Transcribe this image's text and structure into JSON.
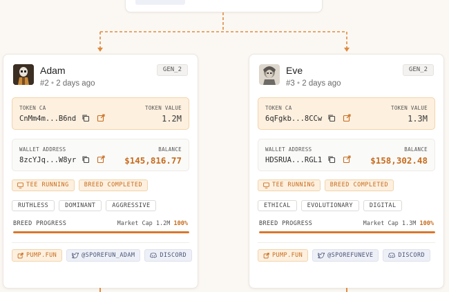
{
  "colors": {
    "accent": "#d9772a",
    "accent_text": "#c76b1c",
    "accent_bg": "#fdf0df"
  },
  "cards": [
    {
      "name": "Adam",
      "meta_id": "#2",
      "meta_time": "2 days ago",
      "gen": "GEN_2",
      "token_label": "TOKEN CA",
      "token_address": "CnMm4m...B6nd",
      "token_value_label": "TOKEN VALUE",
      "token_value": "1.2M",
      "wallet_label": "WALLET ADDRESS",
      "wallet_address": "8zcYJq...W8yr",
      "balance_label": "BALANCE",
      "balance": "$145,816.77",
      "status_badges": [
        "TEE RUNNING",
        "BREED COMPLETED"
      ],
      "traits": [
        "RUTHLESS",
        "DOMINANT",
        "AGGRESSIVE"
      ],
      "progress_label": "BREED PROGRESS",
      "market_cap": "Market Cap 1.2M",
      "progress_text": "100%",
      "progress_pct": 100,
      "links": {
        "pump": "PUMP.FUN",
        "twitter": "@SPOREFUN_ADAM",
        "discord": "DISCORD"
      }
    },
    {
      "name": "Eve",
      "meta_id": "#3",
      "meta_time": "2 days ago",
      "gen": "GEN_2",
      "token_label": "TOKEN CA",
      "token_address": "6qFgkb...8CCw",
      "token_value_label": "TOKEN VALUE",
      "token_value": "1.3M",
      "wallet_label": "WALLET ADDRESS",
      "wallet_address": "HDSRUA...RGL1",
      "balance_label": "BALANCE",
      "balance": "$158,302.48",
      "status_badges": [
        "TEE RUNNING",
        "BREED COMPLETED"
      ],
      "traits": [
        "ETHICAL",
        "EVOLUTIONARY",
        "DIGITAL"
      ],
      "progress_label": "BREED PROGRESS",
      "market_cap": "Market Cap 1.3M",
      "progress_text": "100%",
      "progress_pct": 100,
      "links": {
        "pump": "PUMP.FUN",
        "twitter": "@SPOREFUNEVE",
        "discord": "DISCORD"
      }
    }
  ],
  "icons": {
    "copy": "copy-icon",
    "external": "external-link-icon",
    "monitor": "monitor-icon",
    "twitter": "twitter-bird-icon",
    "discord": "discord-icon"
  }
}
